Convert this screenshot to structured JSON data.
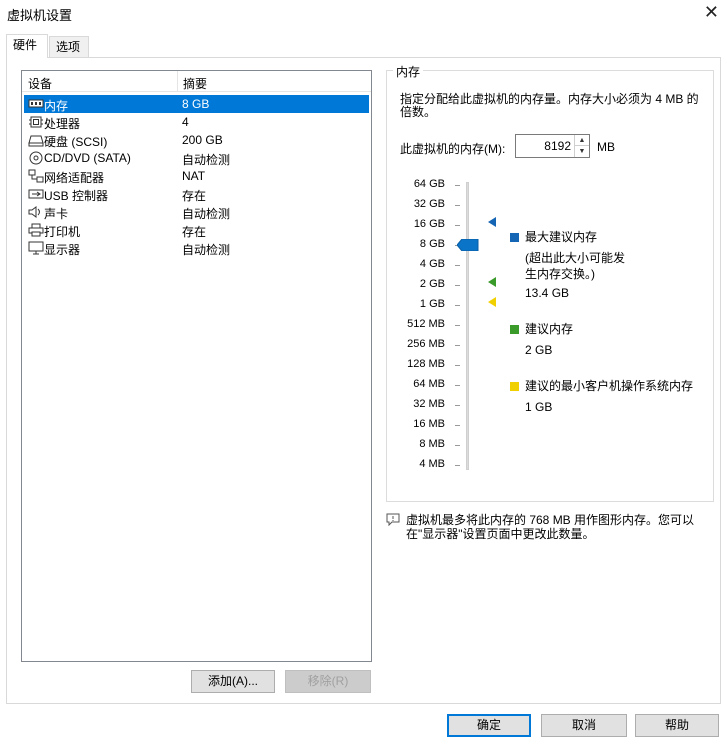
{
  "window": {
    "title": "虚拟机设置",
    "close_glyph": "✕"
  },
  "tabs": [
    {
      "label": "硬件"
    },
    {
      "label": "选项"
    }
  ],
  "devices": {
    "header": {
      "device": "设备",
      "summary": "摘要"
    },
    "rows": [
      {
        "name": "内存",
        "summary": "8 GB",
        "icon": "memory-icon"
      },
      {
        "name": "处理器",
        "summary": "4",
        "icon": "processor-icon"
      },
      {
        "name": "硬盘 (SCSI)",
        "summary": "200 GB",
        "icon": "hard-disk-icon"
      },
      {
        "name": "CD/DVD (SATA)",
        "summary": "自动检测",
        "icon": "cd-dvd-icon"
      },
      {
        "name": "网络适配器",
        "summary": "NAT",
        "icon": "network-adapter-icon"
      },
      {
        "name": "USB 控制器",
        "summary": "存在",
        "icon": "usb-icon"
      },
      {
        "name": "声卡",
        "summary": "自动检测",
        "icon": "sound-card-icon"
      },
      {
        "name": "打印机",
        "summary": "存在",
        "icon": "printer-icon"
      },
      {
        "name": "显示器",
        "summary": "自动检测",
        "icon": "display-icon"
      }
    ],
    "selected": "内存"
  },
  "buttons": {
    "add": "添加(A)...",
    "remove": "移除(R)",
    "ok": "确定",
    "cancel": "取消",
    "help": "帮助"
  },
  "memory": {
    "group_title": "内存",
    "description": "指定分配给此虚拟机的内存量。内存大小必须为 4 MB 的倍数。",
    "field_label": "此虚拟机的内存(M):",
    "value": "8192",
    "unit": "MB",
    "scale": [
      "64 GB",
      "32 GB",
      "16 GB",
      "8 GB",
      "4 GB",
      "2 GB",
      "1 GB",
      "512 MB",
      "256 MB",
      "128 MB",
      "64 MB",
      "32 MB",
      "16 MB",
      "8 MB",
      "4 MB"
    ],
    "slider_value": "8 GB",
    "legend": {
      "max": {
        "label": "最大建议内存",
        "note": "(超出此大小可能发生内存交换。)",
        "value": "13.4 GB",
        "color": "#1565b5"
      },
      "recommended": {
        "label": "建议内存",
        "value": "2 GB",
        "color": "#3a9a2a"
      },
      "min": {
        "label": "建议的最小客户机操作系统内存",
        "value": "1 GB",
        "color": "#f0d000"
      }
    }
  },
  "info_note": "虚拟机最多将此内存的 768 MB 用作图形内存。您可以在\"显示器\"设置页面中更改此数量。"
}
